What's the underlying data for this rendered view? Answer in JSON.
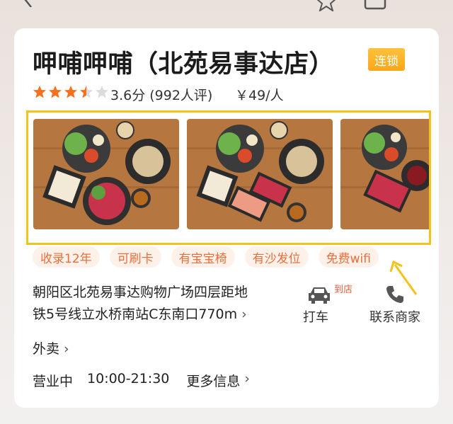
{
  "shop": {
    "name": "呷哺呷哺（北苑易事达店）",
    "chain_badge": "连锁",
    "rating_stars": 3.5,
    "rating_text": "3.6分 (992人评)",
    "price": "￥49/人"
  },
  "tags": [
    "收录12年",
    "可刷卡",
    "有宝宝椅",
    "有沙发位",
    "免费wifi"
  ],
  "address": {
    "line1": "朝阳区北苑易事达购物广场四层距地",
    "line2": "铁5号线立水桥南站C东南口770m",
    "chevron": "›"
  },
  "actions": {
    "taxi_label": "打车",
    "taxi_badge": "到店",
    "contact_label": "联系商家"
  },
  "takeout": {
    "label": "外卖",
    "chevron": "›"
  },
  "hours": {
    "status": "营业中",
    "time": "10:00-21:30",
    "more": "更多信息",
    "chevron": "›"
  },
  "colors": {
    "chain_badge": "#fba619",
    "star": "#f5701f",
    "tag_text": "#ee6e3a",
    "gallery_border": "#f2c318",
    "annotation_arrow": "#f2c318"
  },
  "icons": [
    "back-arrow-icon",
    "star-outline-icon",
    "share-box-icon",
    "car-icon",
    "phone-icon",
    "chevron-right-icon"
  ]
}
